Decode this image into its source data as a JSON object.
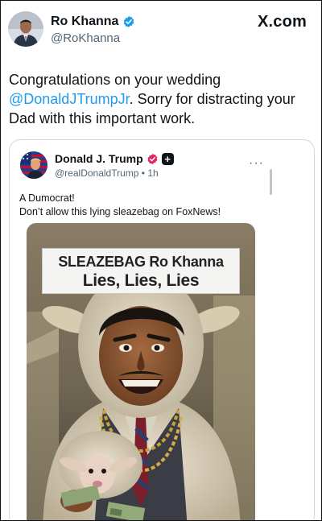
{
  "header": {
    "name": "Ro Khanna",
    "handle": "@RoKhanna",
    "site": "X.com"
  },
  "tweet": {
    "text_before": "Congratulations on your wedding ",
    "mention": "@DonaldJTrumpJr",
    "text_after": ". Sorry for distracting your Dad with this important work."
  },
  "quote": {
    "name": "Donald J. Trump",
    "handle": "@realDonaldTrump",
    "time": "1h",
    "more": "···",
    "line1": "A Dumocrat!",
    "line2": "Don’t allow this lying sleazebag on FoxNews!",
    "meme_line1": "SLEAZEBAG Ro Khanna",
    "meme_line2": "Lies, Lies, Lies"
  },
  "icons": {
    "verified": "verified-badge-icon",
    "affiliate": "pink-badge-icon",
    "plus": "plus-badge-icon"
  },
  "colors": {
    "mention": "#1d9bf0",
    "verified": "#1d9bf0",
    "affiliate": "#e0245e",
    "secondary_text": "#536471"
  }
}
